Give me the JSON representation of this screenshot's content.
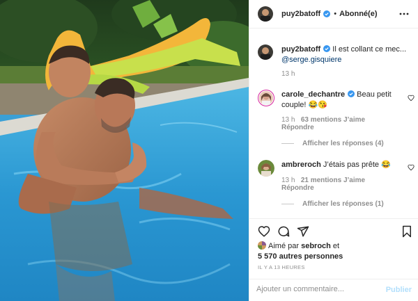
{
  "post": {
    "author": "puy2batoff",
    "follow_status": "Abonné(e)",
    "separator": "•"
  },
  "caption": {
    "username": "puy2batoff",
    "text": " Il est collant ce mec...",
    "mention": "@serge.gisquiere",
    "time": "13 h"
  },
  "comments": [
    {
      "username": "carole_dechantre",
      "verified": true,
      "text": " Beau petit couple! 😂😘",
      "time": "13 h",
      "likes": "63 mentions J’aime",
      "reply": "Répondre",
      "view_replies": "Afficher les réponses (4)"
    },
    {
      "username": "ambreroch",
      "verified": false,
      "text": " J’étais pas prête 😂",
      "time": "13 h",
      "likes": "21 mentions J’aime",
      "reply": "Répondre",
      "view_replies": "Afficher les réponses (1)"
    }
  ],
  "likes": {
    "prefix": "Aimé par ",
    "user": "sebroch",
    "suffix": " et",
    "others": "5 570 autres personnes"
  },
  "timestamp": "IL Y A 13 HEURES",
  "comment_box": {
    "placeholder": "Ajouter un commentaire...",
    "publish": "Publier"
  },
  "colors": {
    "verified_blue": "#3897f0",
    "link": "#00376b",
    "muted": "#8e8e8e",
    "publish_disabled": "#b2dffc"
  },
  "icons": [
    "more-icon",
    "heart-icon",
    "comment-icon",
    "share-icon",
    "bookmark-icon",
    "verified-badge-icon"
  ]
}
